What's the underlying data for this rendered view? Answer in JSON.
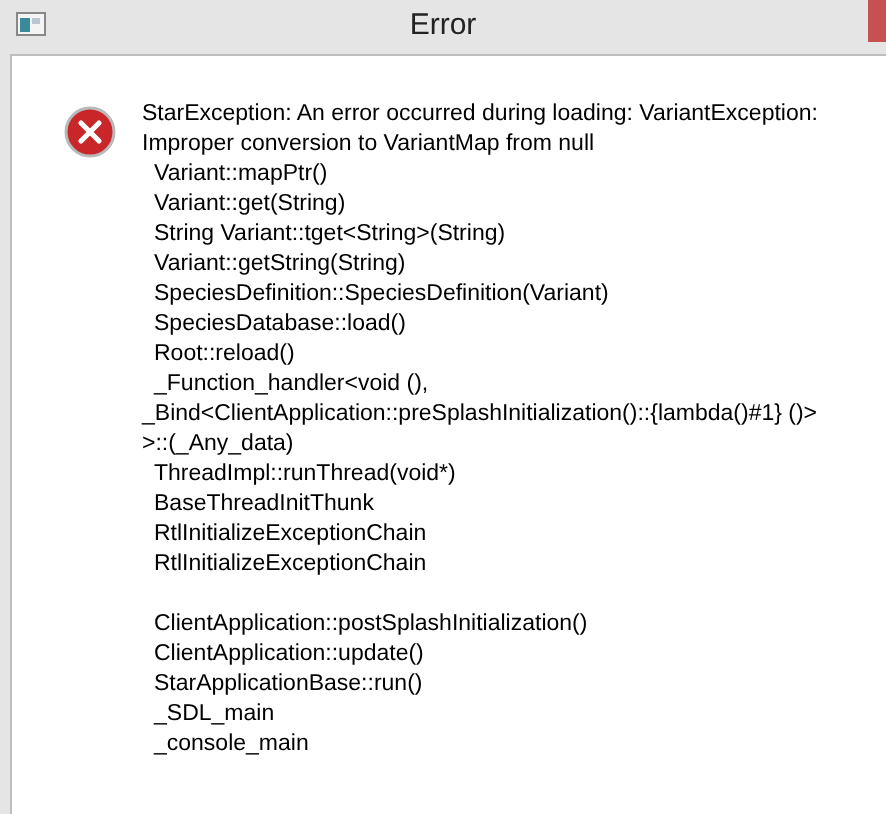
{
  "window": {
    "title": "Error"
  },
  "message": {
    "lines": [
      {
        "text": "StarException: An error occurred during loading: VariantException:",
        "indented": false
      },
      {
        "text": "Improper conversion to VariantMap from null",
        "indented": false
      },
      {
        "text": "Variant::mapPtr()",
        "indented": true
      },
      {
        "text": "Variant::get(String)",
        "indented": true
      },
      {
        "text": "String Variant::tget<String>(String)",
        "indented": true
      },
      {
        "text": "Variant::getString(String)",
        "indented": true
      },
      {
        "text": "SpeciesDefinition::SpeciesDefinition(Variant)",
        "indented": true
      },
      {
        "text": "SpeciesDatabase::load()",
        "indented": true
      },
      {
        "text": "Root::reload()",
        "indented": true
      },
      {
        "text": "_Function_handler<void (),",
        "indented": true
      },
      {
        "text": "_Bind<ClientApplication::preSplashInitialization()::{lambda()#1} ()>",
        "indented": false
      },
      {
        "text": ">::(_Any_data)",
        "indented": false
      },
      {
        "text": "ThreadImpl::runThread(void*)",
        "indented": true
      },
      {
        "text": "BaseThreadInitThunk",
        "indented": true
      },
      {
        "text": "RtlInitializeExceptionChain",
        "indented": true
      },
      {
        "text": "RtlInitializeExceptionChain",
        "indented": true
      },
      {
        "text": "ClientApplication::postSplashInitialization()",
        "indented": true,
        "blank_before": true
      },
      {
        "text": "ClientApplication::update()",
        "indented": true
      },
      {
        "text": "StarApplicationBase::run()",
        "indented": true
      },
      {
        "text": "_SDL_main",
        "indented": true
      },
      {
        "text": "_console_main",
        "indented": true
      }
    ]
  }
}
